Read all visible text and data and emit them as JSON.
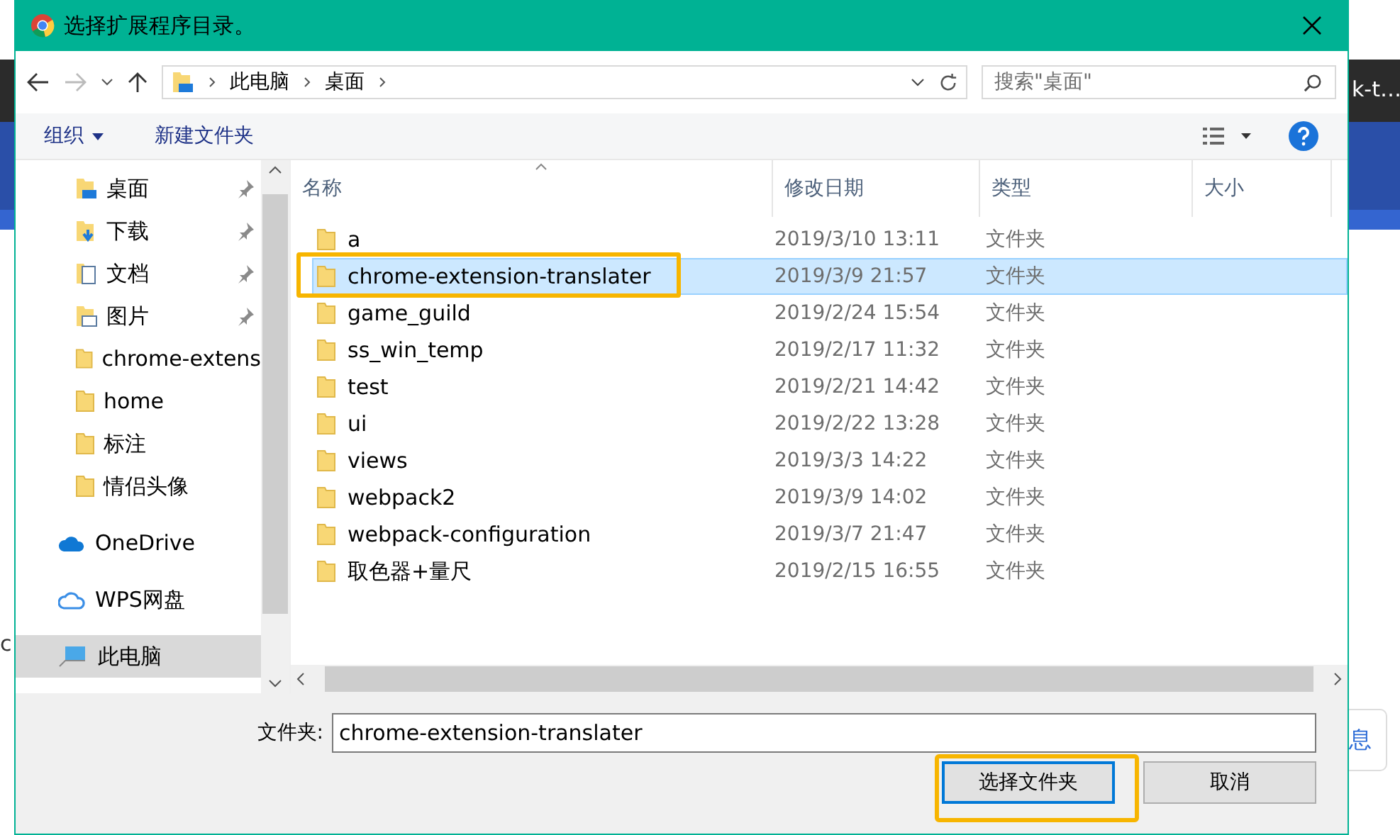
{
  "background": {
    "left_fragments": [
      "c"
    ],
    "right_fragments": [
      "k-t…"
    ],
    "button_fragment": "息"
  },
  "window": {
    "title": "选择扩展程序目录。"
  },
  "address": {
    "crumbs": [
      "此电脑",
      "桌面"
    ],
    "search_placeholder": "搜索\"桌面\""
  },
  "toolbar": {
    "organize": "组织",
    "new_folder": "新建文件夹"
  },
  "sidebar": {
    "items": [
      {
        "label": "桌面",
        "kind": "desktop",
        "pinned": true,
        "selected": false
      },
      {
        "label": "下载",
        "kind": "download",
        "pinned": true,
        "selected": false
      },
      {
        "label": "文档",
        "kind": "document",
        "pinned": true,
        "selected": false
      },
      {
        "label": "图片",
        "kind": "pictures",
        "pinned": true,
        "selected": false
      },
      {
        "label": "chrome-extens",
        "kind": "folder",
        "pinned": false,
        "selected": false
      },
      {
        "label": "home",
        "kind": "folder",
        "pinned": false,
        "selected": false
      },
      {
        "label": "标注",
        "kind": "folder",
        "pinned": false,
        "selected": false
      },
      {
        "label": "情侣头像",
        "kind": "folder",
        "pinned": false,
        "selected": false
      },
      {
        "label": "OneDrive",
        "kind": "onedrive",
        "pinned": false,
        "selected": false
      },
      {
        "label": "WPS网盘",
        "kind": "cloud",
        "pinned": false,
        "selected": false
      },
      {
        "label": "此电脑",
        "kind": "pc",
        "pinned": false,
        "selected": true
      }
    ]
  },
  "table": {
    "columns": [
      "名称",
      "修改日期",
      "类型",
      "大小"
    ],
    "rows": [
      {
        "name": "a",
        "date": "2019/3/10 13:11",
        "type": "文件夹",
        "selected": false,
        "highlighted": false
      },
      {
        "name": "chrome-extension-translater",
        "date": "2019/3/9 21:57",
        "type": "文件夹",
        "selected": true,
        "highlighted": true
      },
      {
        "name": "game_guild",
        "date": "2019/2/24 15:54",
        "type": "文件夹",
        "selected": false,
        "highlighted": false
      },
      {
        "name": "ss_win_temp",
        "date": "2019/2/17 11:32",
        "type": "文件夹",
        "selected": false,
        "highlighted": false
      },
      {
        "name": "test",
        "date": "2019/2/21 14:42",
        "type": "文件夹",
        "selected": false,
        "highlighted": false
      },
      {
        "name": "ui",
        "date": "2019/2/22 13:28",
        "type": "文件夹",
        "selected": false,
        "highlighted": false
      },
      {
        "name": "views",
        "date": "2019/3/3 14:22",
        "type": "文件夹",
        "selected": false,
        "highlighted": false
      },
      {
        "name": "webpack2",
        "date": "2019/3/9 14:02",
        "type": "文件夹",
        "selected": false,
        "highlighted": false
      },
      {
        "name": "webpack-configuration",
        "date": "2019/3/7 21:47",
        "type": "文件夹",
        "selected": false,
        "highlighted": false
      },
      {
        "name": "取色器+量尺",
        "date": "2019/2/15 16:55",
        "type": "文件夹",
        "selected": false,
        "highlighted": false
      }
    ]
  },
  "footer": {
    "field_label": "文件夹:",
    "field_value": "chrome-extension-translater",
    "buttons": [
      {
        "label": "选择文件夹",
        "kind": "primary",
        "highlighted": true
      },
      {
        "label": "取消",
        "kind": "normal",
        "highlighted": false
      }
    ]
  }
}
